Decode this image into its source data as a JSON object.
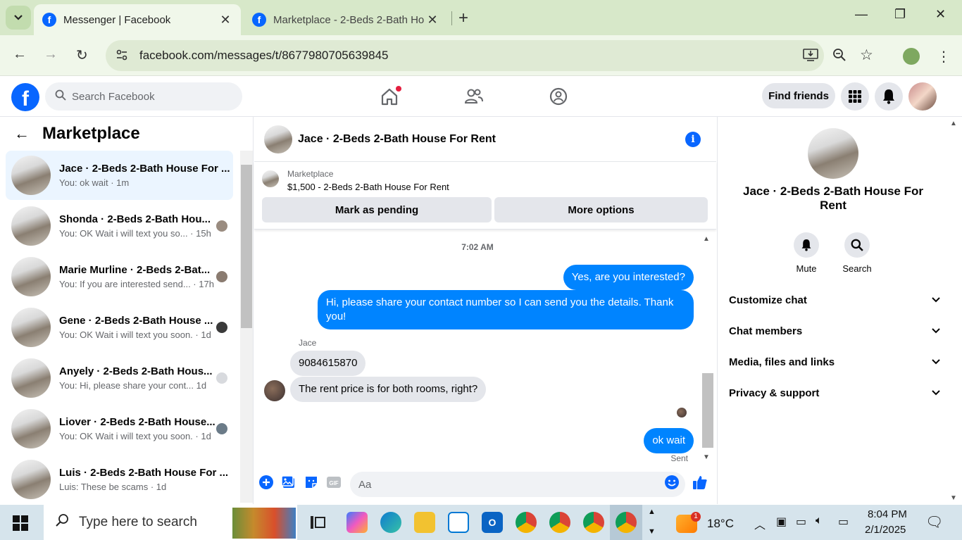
{
  "browser": {
    "tabs": [
      {
        "title": "Messenger | Facebook",
        "active": true
      },
      {
        "title": "Marketplace - 2-Beds 2-Bath Ho",
        "active": false
      }
    ],
    "url": "facebook.com/messages/t/8677980705639845"
  },
  "fb_header": {
    "search_placeholder": "Search Facebook",
    "find_friends_label": "Find friends"
  },
  "left": {
    "title": "Marketplace",
    "conversations": [
      {
        "name": "Jace · 2-Beds 2-Bath House For ...",
        "preview": "You: ok wait · 1m"
      },
      {
        "name": "Shonda · 2-Beds 2-Bath Hou...",
        "preview": "You: OK Wait i will text you so... · 15h"
      },
      {
        "name": "Marie Murline · 2-Beds 2-Bat...",
        "preview": "You: If you are interested send... · 17h"
      },
      {
        "name": "Gene · 2-Beds 2-Bath House ...",
        "preview": "You: OK Wait i will text you soon. · 1d"
      },
      {
        "name": "Anyely · 2-Beds 2-Bath Hous...",
        "preview": "You: Hi, please share your cont...   1d"
      },
      {
        "name": "Liover · 2-Beds 2-Bath House...",
        "preview": "You: OK Wait i will text you soon. · 1d"
      },
      {
        "name": "Luis · 2-Beds 2-Bath House For ...",
        "preview": "Luis: These be scams · 1d"
      }
    ]
  },
  "chat": {
    "title": "Jace · 2-Beds 2-Bath House For Rent",
    "marketplace_label": "Marketplace",
    "listing": "$1,500 - 2-Beds 2-Bath House For Rent",
    "mark_pending_label": "Mark as pending",
    "more_options_label": "More options",
    "time_label": "7:02 AM",
    "messages": [
      {
        "from": "me",
        "text": "Yes, are you interested?"
      },
      {
        "from": "me",
        "text": "Hi, please share your contact number so I can send you the details. Thank you!"
      },
      {
        "from": "them",
        "sender": "Jace",
        "text": "9084615870"
      },
      {
        "from": "them",
        "text": "The rent price is for both rooms, right?"
      },
      {
        "from": "me",
        "text": "ok wait"
      }
    ],
    "sent_label": "Sent",
    "composer_placeholder": "Aa"
  },
  "right": {
    "name": "Jace · 2-Beds 2-Bath House For Rent",
    "actions": [
      {
        "label": "Mute",
        "icon": "bell-icon"
      },
      {
        "label": "Search",
        "icon": "search-icon"
      }
    ],
    "sections": [
      "Customize chat",
      "Chat members",
      "Media, files and links",
      "Privacy & support"
    ]
  },
  "taskbar": {
    "search_placeholder": "Type here to search",
    "weather": "18°C",
    "weather_badge": "1",
    "time": "8:04 PM",
    "date": "2/1/2025"
  },
  "colors": {
    "fb_blue": "#0866ff",
    "messenger_bubble": "#0084ff",
    "tab_bar": "#d7e8c9"
  }
}
